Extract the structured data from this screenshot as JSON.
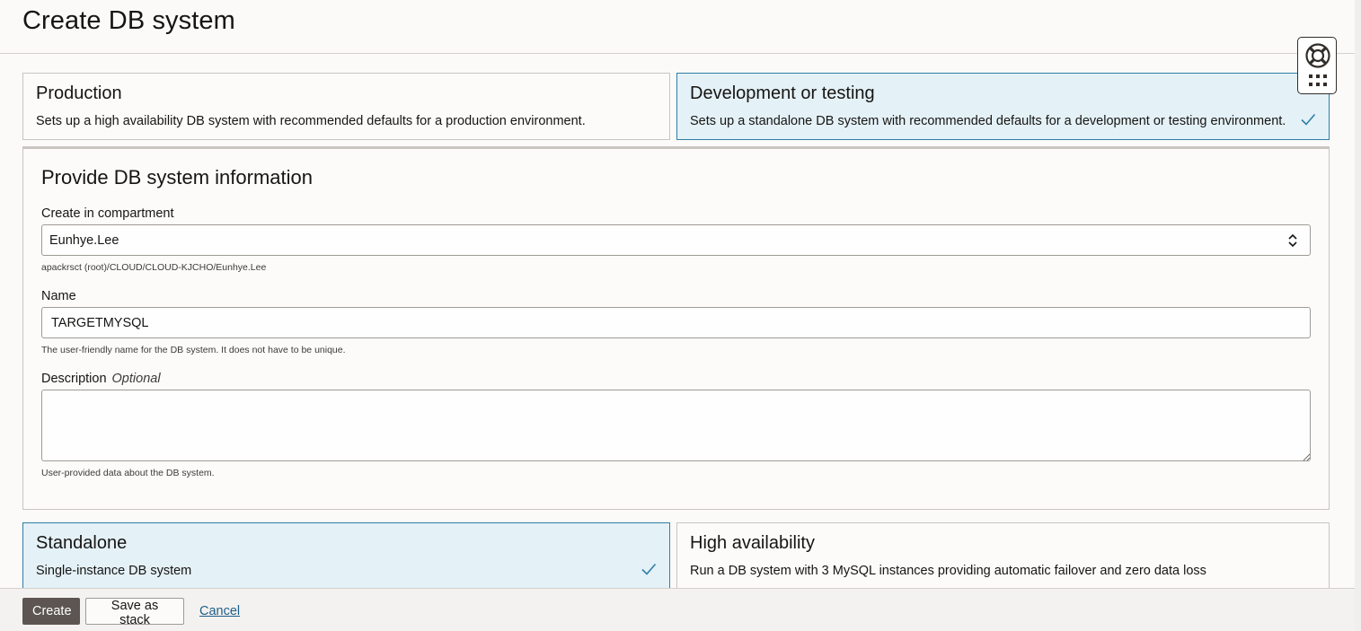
{
  "page": {
    "title": "Create DB system"
  },
  "preset_options": [
    {
      "title": "Production",
      "description": "Sets up a high availability DB system with recommended defaults for a production environment.",
      "selected": false
    },
    {
      "title": "Development or testing",
      "description": "Sets up a standalone DB system with recommended defaults for a development or testing environment.",
      "selected": true
    }
  ],
  "db_info": {
    "section_title": "Provide DB system information",
    "compartment": {
      "label": "Create in compartment",
      "value": "Eunhye.Lee",
      "path": "apackrsct (root)/CLOUD/CLOUD-KJCHO/Eunhye.Lee"
    },
    "name": {
      "label": "Name",
      "value": "TARGETMYSQL",
      "help": "The user-friendly name for the DB system. It does not have to be unique."
    },
    "description": {
      "label": "Description",
      "optional_label": "Optional",
      "value": "",
      "help": "User-provided data about the DB system."
    }
  },
  "deployment_options": [
    {
      "title": "Standalone",
      "description": "Single-instance DB system",
      "selected": true
    },
    {
      "title": "High availability",
      "description": "Run a DB system with 3 MySQL instances providing automatic failover and zero data loss",
      "selected": false
    }
  ],
  "footer": {
    "create_label": "Create",
    "save_stack_label": "Save as stack",
    "cancel_label": "Cancel"
  },
  "colors": {
    "selected_card_bg": "#e4f1f7",
    "selected_card_border": "#2f7fa6",
    "primary_button": "#5c5551",
    "link": "#1d5f8a"
  },
  "icons": [
    "help-lifebuoy-icon",
    "apps-grid-icon",
    "checkmark-icon",
    "chevron-updown-icon",
    "resize-grip-icon"
  ]
}
